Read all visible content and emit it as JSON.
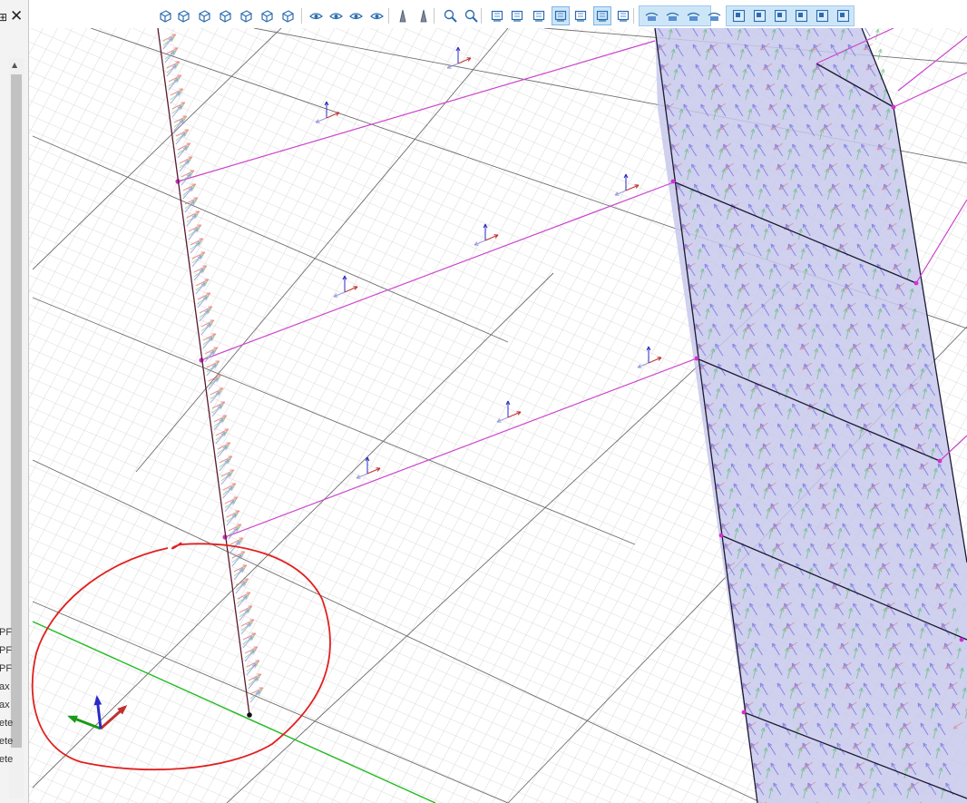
{
  "left_panel": {
    "pin_glyph": "⊞",
    "close_glyph": "✕",
    "truncated_labels": [
      "PF",
      "PF",
      "PF",
      "ax",
      "ax",
      "ete",
      "ete",
      "ete"
    ]
  },
  "toolbar": {
    "buttons": [
      {
        "icon": "view-iso-icon"
      },
      {
        "icon": "view-front-icon"
      },
      {
        "icon": "view-back-icon"
      },
      {
        "icon": "view-left-icon"
      },
      {
        "icon": "view-right-icon"
      },
      {
        "icon": "view-top-icon"
      },
      {
        "icon": "view-bottom-icon"
      },
      {
        "icon": "visibility-icon"
      },
      {
        "icon": "show-icon"
      },
      {
        "icon": "hide-icon"
      },
      {
        "icon": "snapshot-icon"
      },
      {
        "icon": "perspective-icon"
      },
      {
        "icon": "column-icon"
      },
      {
        "icon": "zoom-all-icon"
      },
      {
        "icon": "zoom-window-icon"
      },
      {
        "icon": "display-icon"
      },
      {
        "icon": "measure-icon"
      },
      {
        "icon": "grid-icon"
      },
      {
        "icon": "grid-active-icon"
      },
      {
        "icon": "axes-icon"
      },
      {
        "icon": "select-icon"
      },
      {
        "icon": "deselect-icon"
      },
      {
        "icon": "section-view-1-icon"
      },
      {
        "icon": "section-view-2-icon"
      },
      {
        "icon": "section-view-3-icon"
      },
      {
        "icon": "section-view-4-icon"
      },
      {
        "icon": "layer-1-icon"
      },
      {
        "icon": "layer-2-icon"
      },
      {
        "icon": "layer-3-icon"
      },
      {
        "icon": "layer-4-icon"
      },
      {
        "icon": "layer-5-icon"
      },
      {
        "icon": "layer-6-icon"
      }
    ]
  },
  "colors": {
    "grid_major": "#6e6e6e",
    "grid_minor": "#c8c8c8",
    "member": "#5a1a2a",
    "beam": "#cc44cc",
    "surface_fill": "#c8c8ec",
    "surface_edge": "#1a1a33",
    "axis_x": "#c03030",
    "axis_y": "#1a9a1a",
    "axis_z": "#2a2ac8",
    "ground_line": "#22bb22",
    "annotation": "#e02020"
  }
}
